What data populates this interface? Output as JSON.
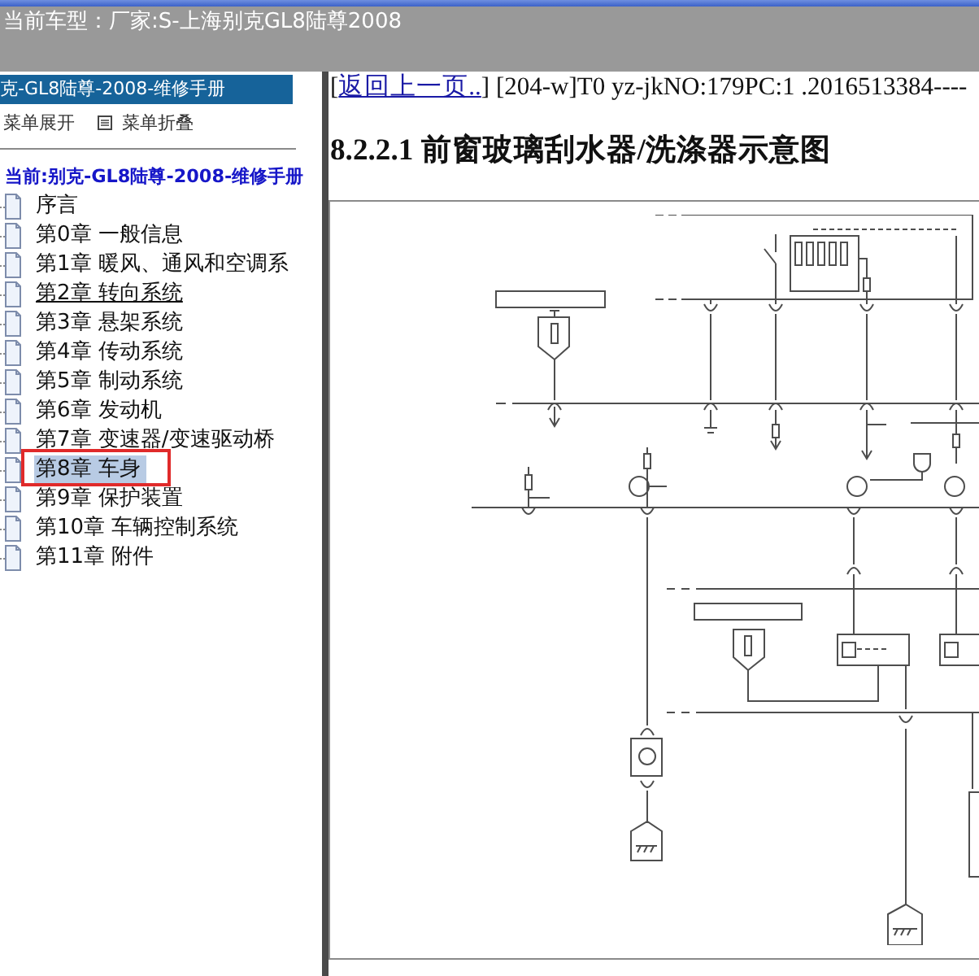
{
  "header": {
    "vehicle_label": "当前车型：",
    "vehicle": "厂家:S-上海别克GL8陆尊2008"
  },
  "sidebar": {
    "title": "克-GL8陆尊-2008-维修手册",
    "toolbar": [
      {
        "label": "菜单展开",
        "has_icon": false
      },
      {
        "label": "菜单折叠",
        "has_icon": true
      }
    ],
    "current": "当前:别克-GL8陆尊-2008-维修手册",
    "items": [
      {
        "label": "序言",
        "selected": false,
        "hovered": false,
        "annotated": false
      },
      {
        "label": "第0章 一般信息",
        "selected": false,
        "hovered": false,
        "annotated": false
      },
      {
        "label": "第1章 暖风、通风和空调系",
        "selected": false,
        "hovered": false,
        "annotated": false
      },
      {
        "label": "第2章 转向系统",
        "selected": false,
        "hovered": true,
        "annotated": false
      },
      {
        "label": "第3章 悬架系统",
        "selected": false,
        "hovered": false,
        "annotated": false
      },
      {
        "label": "第4章 传动系统",
        "selected": false,
        "hovered": false,
        "annotated": false
      },
      {
        "label": "第5章 制动系统",
        "selected": false,
        "hovered": false,
        "annotated": false
      },
      {
        "label": "第6章 发动机",
        "selected": false,
        "hovered": false,
        "annotated": false
      },
      {
        "label": "第7章 变速器/变速驱动桥",
        "selected": false,
        "hovered": false,
        "annotated": false
      },
      {
        "label": "第8章 车身",
        "selected": true,
        "hovered": false,
        "annotated": true
      },
      {
        "label": "第9章 保护装置",
        "selected": false,
        "hovered": false,
        "annotated": false
      },
      {
        "label": "第10章 车辆控制系统",
        "selected": false,
        "hovered": false,
        "annotated": false
      },
      {
        "label": "第11章 附件",
        "selected": false,
        "hovered": false,
        "annotated": false
      }
    ]
  },
  "content": {
    "nav": {
      "before": "[",
      "link": "返回上一页..",
      "after": "] [204-w]T0 yz-jkNO:179PC:1 .2016513384----"
    },
    "heading": "8.2.2.1 前窗玻璃刮水器/洗涤器示意图",
    "figure": {
      "kind": "wiring-diagram"
    }
  }
}
